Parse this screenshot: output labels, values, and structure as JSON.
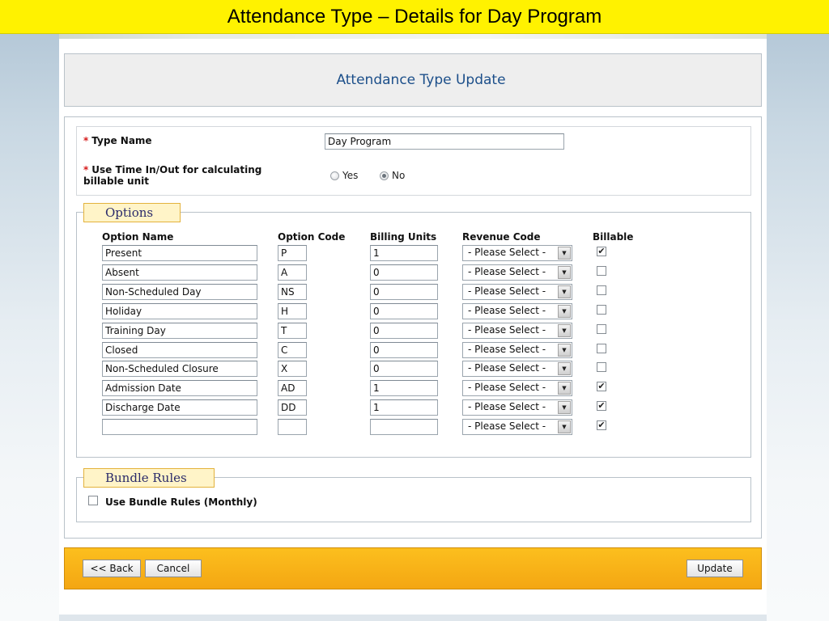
{
  "slide_title": "Attendance Type – Details for Day Program",
  "header": {
    "title": "Attendance Type Update"
  },
  "type_section": {
    "required_marker": "*",
    "type_name_label": "Type Name",
    "type_name_value": "Day Program",
    "time_label_line1": "Use Time In/Out for calculating",
    "time_label_line2": "billable unit",
    "radio_yes_label": "Yes",
    "radio_no_label": "No",
    "selected": "No"
  },
  "options": {
    "legend": "Options",
    "columns": {
      "option_name": "Option Name",
      "option_code": "Option Code",
      "billing_units": "Billing Units",
      "revenue_code": "Revenue Code",
      "billable": "Billable"
    },
    "rows": [
      {
        "name": "Present",
        "code": "P",
        "units": "1",
        "revenue": "- Please Select -",
        "billable": true
      },
      {
        "name": "Absent",
        "code": "A",
        "units": "0",
        "revenue": "- Please Select -",
        "billable": false
      },
      {
        "name": "Non-Scheduled Day",
        "code": "NS",
        "units": "0",
        "revenue": "- Please Select -",
        "billable": false
      },
      {
        "name": "Holiday",
        "code": "H",
        "units": "0",
        "revenue": "- Please Select -",
        "billable": false
      },
      {
        "name": "Training Day",
        "code": "T",
        "units": "0",
        "revenue": "- Please Select -",
        "billable": false
      },
      {
        "name": "Closed",
        "code": "C",
        "units": "0",
        "revenue": "- Please Select -",
        "billable": false
      },
      {
        "name": "Non-Scheduled Closure",
        "code": "X",
        "units": "0",
        "revenue": "- Please Select -",
        "billable": false
      },
      {
        "name": "Admission Date",
        "code": "AD",
        "units": "1",
        "revenue": "- Please Select -",
        "billable": true
      },
      {
        "name": "Discharge Date",
        "code": "DD",
        "units": "1",
        "revenue": "- Please Select -",
        "billable": true
      },
      {
        "name": "",
        "code": "",
        "units": "",
        "revenue": "- Please Select -",
        "billable": true
      }
    ]
  },
  "bundle_rules": {
    "legend": "Bundle Rules",
    "checkbox_label": "Use Bundle Rules (Monthly)",
    "checked": false
  },
  "buttons": {
    "back": "<< Back",
    "cancel": "Cancel",
    "update": "Update"
  },
  "colors": {
    "title_bar": "#fff200",
    "header_title": "#1c4f8a",
    "footer_bar": "#f8b317",
    "required": "#d61a1a",
    "legend_bg": "#fff4c8"
  },
  "icons": {
    "dropdown_arrow": "chevron-down-icon",
    "check": "check-icon"
  }
}
